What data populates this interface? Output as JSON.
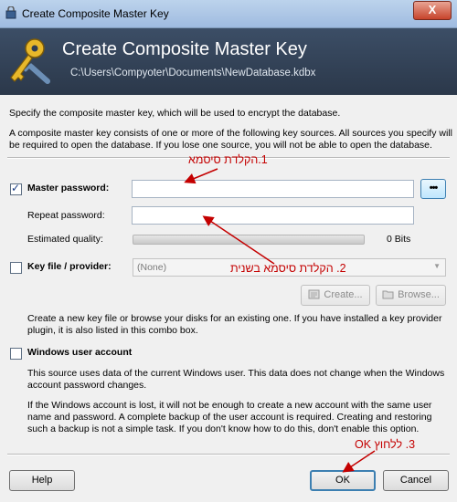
{
  "window": {
    "title": "Create Composite Master Key",
    "close_label": "X"
  },
  "banner": {
    "title": "Create Composite Master Key",
    "path": "C:\\Users\\Compyoter\\Documents\\NewDatabase.kdbx"
  },
  "intro": {
    "line1": "Specify the composite master key, which will be used to encrypt the database.",
    "line2": "A composite master key consists of one or more of the following key sources. All sources you specify will",
    "line3": "be required to open the database.  If you lose one source, you will not be able to open the database."
  },
  "master_password": {
    "checked": true,
    "label": "Master password:",
    "value": "",
    "repeat_label": "Repeat password:",
    "repeat_value": "",
    "quality_label": "Estimated quality:",
    "quality_value": "0 Bits",
    "quality_fraction": 0,
    "dots_label": "•••"
  },
  "key_file": {
    "checked": false,
    "label": "Key file / provider:",
    "selected": "(None)",
    "create_label": "Create...",
    "browse_label": "Browse...",
    "desc1": "Create a new key file or browse your disks for an existing one. If you have installed a key provider",
    "desc2": "plugin, it is also listed in this combo box."
  },
  "windows_account": {
    "checked": false,
    "label": "Windows user account",
    "desc1": "This source uses data of the current Windows user. This data does not change when the Windows",
    "desc2": "account password changes.",
    "desc3": "If the Windows account is lost, it will not be enough to create a new account with the same user",
    "desc4": "name and password. A complete backup of the user account is required. Creating and restoring",
    "desc5": "such a backup is not a simple task. If you don't know how to do this, don't enable this option."
  },
  "buttons": {
    "help": "Help",
    "ok": "OK",
    "cancel": "Cancel"
  },
  "annotations": {
    "a1": "1.הקלדת סיסמא",
    "a2": "2. הקלדת סיסמא בשנית",
    "a3": "3. ללחוץ OK"
  },
  "colors": {
    "banner": "#2f3d52",
    "annotation": "#c40000",
    "accent": "#3c7fb1"
  }
}
